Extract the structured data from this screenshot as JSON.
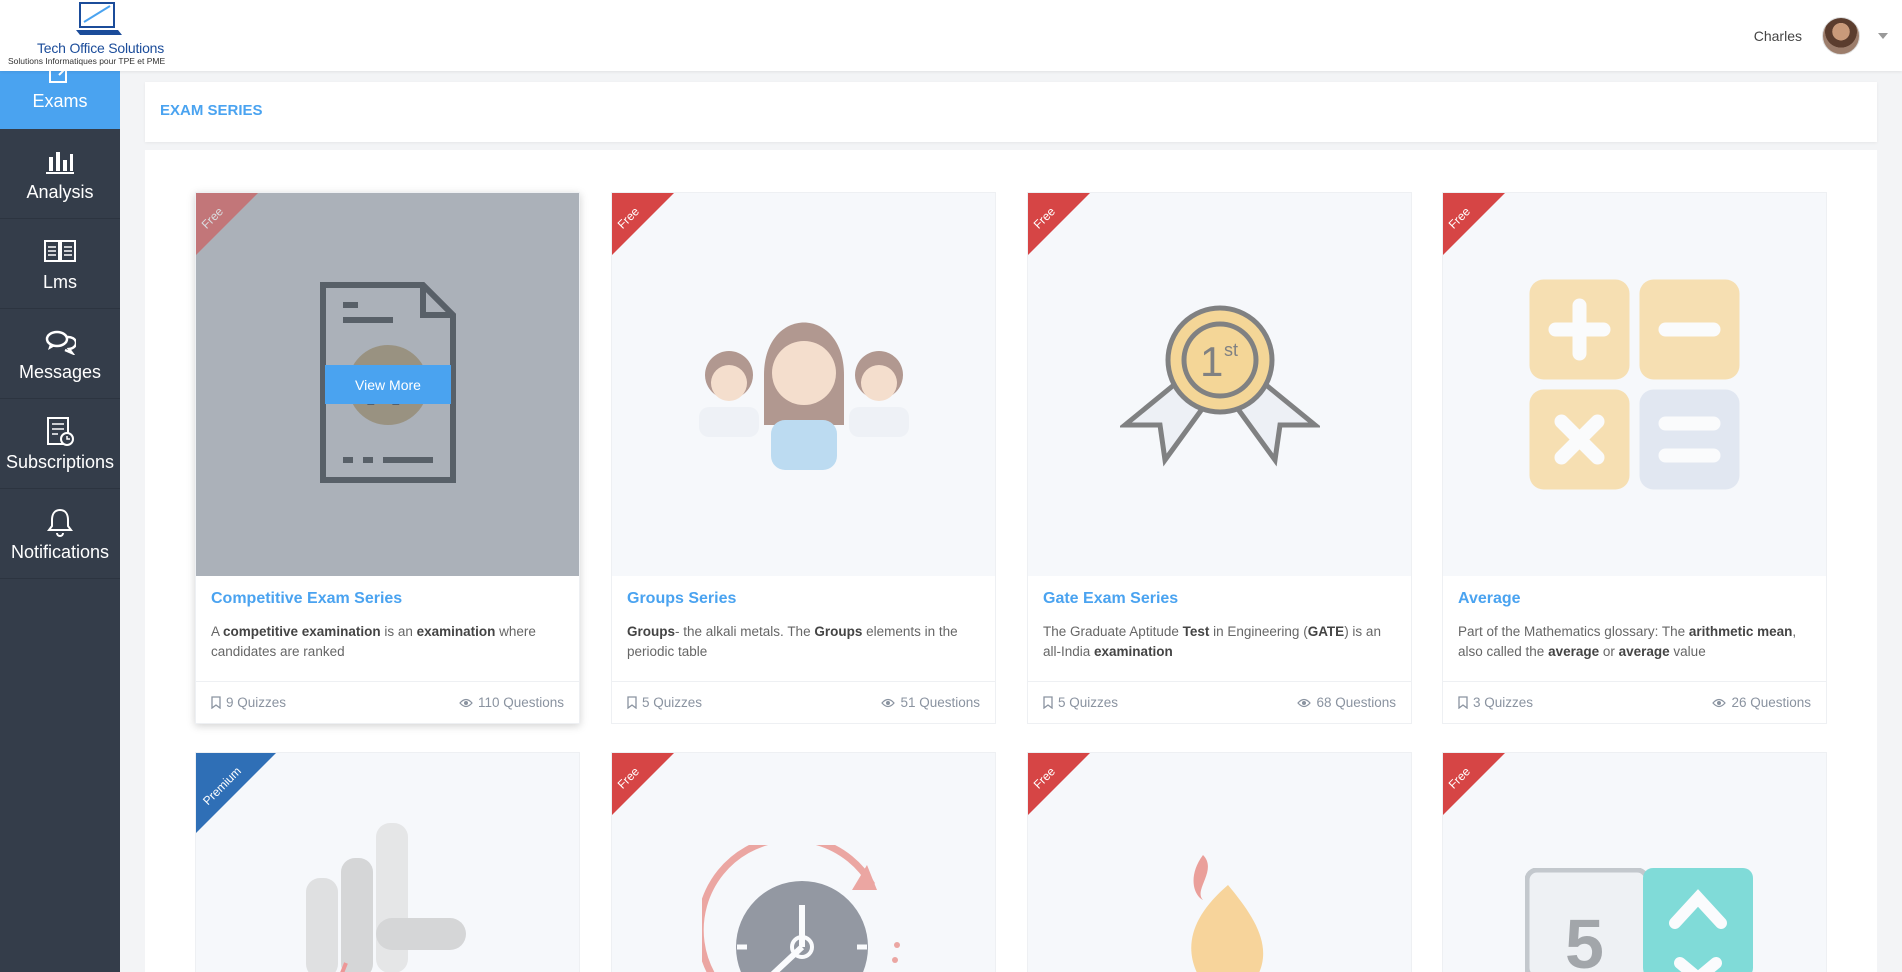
{
  "brand": {
    "name": "Tech Office Solutions",
    "tagline": "Solutions Informatiques pour TPE et PME"
  },
  "user": {
    "name": "Charles"
  },
  "sidebar": {
    "items": [
      {
        "label": "Exams",
        "icon": "edit-icon",
        "active": true
      },
      {
        "label": "Analysis",
        "icon": "bar-chart-icon"
      },
      {
        "label": "Lms",
        "icon": "book-icon"
      },
      {
        "label": "Messages",
        "icon": "chat-icon"
      },
      {
        "label": "Subscriptions",
        "icon": "subscription-icon"
      },
      {
        "label": "Notifications",
        "icon": "bell-icon"
      }
    ]
  },
  "page": {
    "title": "EXAM SERIES",
    "view_more_label": "View More"
  },
  "cards": [
    {
      "badge": "Free",
      "title": "Competitive Exam Series",
      "desc_parts": [
        "A ",
        "competitive examination",
        " is an ",
        "examination",
        " where candidates are ranked"
      ],
      "quizzes": "9 Quizzes",
      "questions": "110 Questions",
      "icon": "exam-paper-icon"
    },
    {
      "badge": "Free",
      "title": "Groups Series",
      "desc_parts": [
        "",
        "Groups",
        "- the alkali metals. The ",
        "Groups",
        " elements in the periodic table"
      ],
      "quizzes": "5 Quizzes",
      "questions": "51 Questions",
      "icon": "people-group-icon"
    },
    {
      "badge": "Free",
      "title": "Gate Exam Series",
      "desc_parts": [
        "The Graduate Aptitude ",
        "Test",
        " in Engineering (",
        "GATE",
        ") is an all-India ",
        "examination",
        ""
      ],
      "quizzes": "5 Quizzes",
      "questions": "68 Questions",
      "icon": "first-place-medal-icon"
    },
    {
      "badge": "Free",
      "title": "Average",
      "desc_parts": [
        "Part of the Mathematics glossary: The ",
        "arithmetic mean",
        ", also called the ",
        "average",
        " or ",
        "average",
        " value"
      ],
      "quizzes": "3 Quizzes",
      "questions": "26 Questions",
      "icon": "calculator-icon"
    },
    {
      "badge": "Premium",
      "icon": "hand-counting-icon"
    },
    {
      "badge": "Free",
      "icon": "clock-refresh-icon"
    },
    {
      "badge": "Free",
      "icon": "flame-icon"
    },
    {
      "badge": "Free",
      "icon": "number-scroll-icon"
    }
  ],
  "colors": {
    "accent": "#4aa3f0",
    "sidebar": "#343d4a",
    "free_badge": "#d64545",
    "premium_badge": "#2f6fb6"
  }
}
